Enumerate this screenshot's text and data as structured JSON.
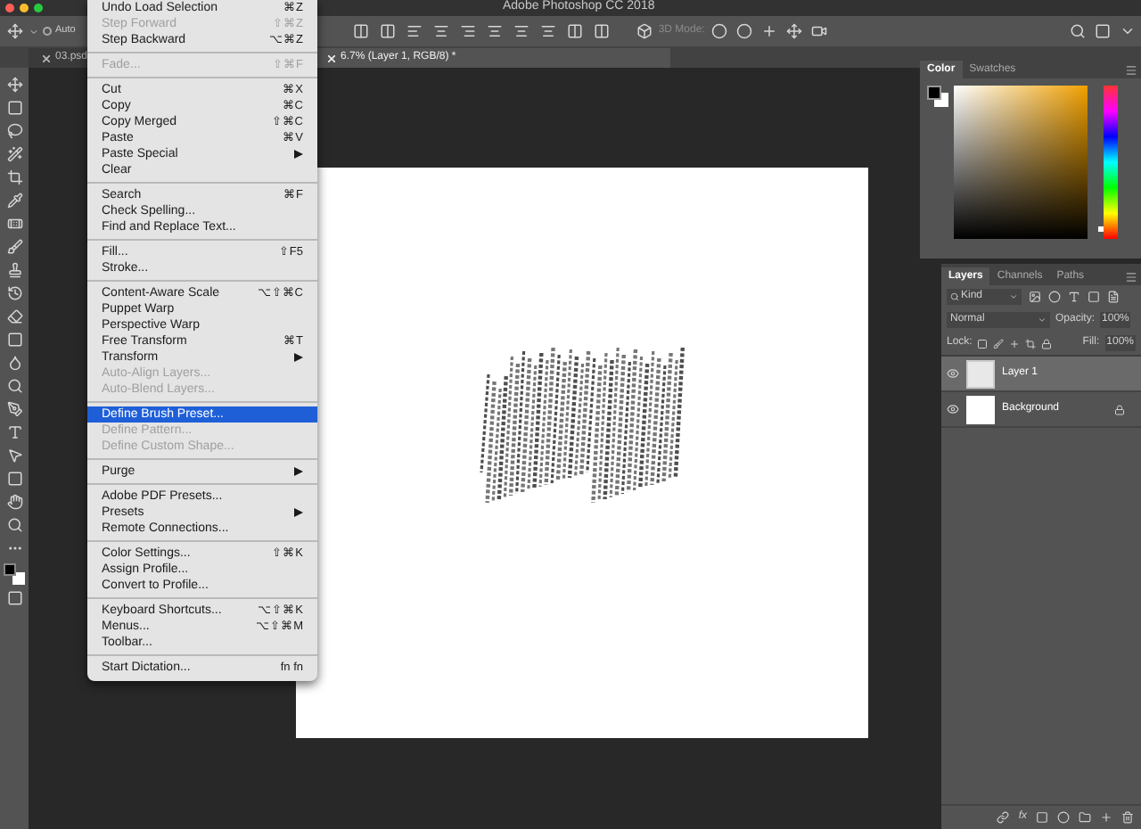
{
  "window": {
    "title": "Adobe Photoshop CC 2018"
  },
  "options_bar": {
    "auto_select": false,
    "auto_label": "Auto",
    "mode_label": "3D Mode:"
  },
  "tabs": [
    {
      "label": "03.psd",
      "selected": false
    },
    {
      "label": "6.7% (Layer 1, RGB/8) *",
      "selected": true
    }
  ],
  "edit_menu": [
    {
      "kind": "item",
      "label": "Undo Load Selection",
      "shortcut": "⌘Z",
      "disabled": false,
      "selected": false,
      "submenu": false
    },
    {
      "kind": "item",
      "label": "Step Forward",
      "shortcut": "⇧⌘Z",
      "disabled": true,
      "selected": false,
      "submenu": false
    },
    {
      "kind": "item",
      "label": "Step Backward",
      "shortcut": "⌥⌘Z",
      "disabled": false,
      "selected": false,
      "submenu": false
    },
    {
      "kind": "separator"
    },
    {
      "kind": "item",
      "label": "Fade...",
      "shortcut": "⇧⌘F",
      "disabled": true,
      "selected": false,
      "submenu": false
    },
    {
      "kind": "separator"
    },
    {
      "kind": "item",
      "label": "Cut",
      "shortcut": "⌘X",
      "disabled": false,
      "selected": false,
      "submenu": false
    },
    {
      "kind": "item",
      "label": "Copy",
      "shortcut": "⌘C",
      "disabled": false,
      "selected": false,
      "submenu": false
    },
    {
      "kind": "item",
      "label": "Copy Merged",
      "shortcut": "⇧⌘C",
      "disabled": false,
      "selected": false,
      "submenu": false
    },
    {
      "kind": "item",
      "label": "Paste",
      "shortcut": "⌘V",
      "disabled": false,
      "selected": false,
      "submenu": false
    },
    {
      "kind": "item",
      "label": "Paste Special",
      "disabled": false,
      "selected": false,
      "submenu": true
    },
    {
      "kind": "item",
      "label": "Clear",
      "disabled": false,
      "selected": false,
      "submenu": false
    },
    {
      "kind": "separator"
    },
    {
      "kind": "item",
      "label": "Search",
      "shortcut": "⌘F",
      "disabled": false,
      "selected": false,
      "submenu": false
    },
    {
      "kind": "item",
      "label": "Check Spelling...",
      "disabled": false,
      "selected": false,
      "submenu": false
    },
    {
      "kind": "item",
      "label": "Find and Replace Text...",
      "disabled": false,
      "selected": false,
      "submenu": false
    },
    {
      "kind": "separator"
    },
    {
      "kind": "item",
      "label": "Fill...",
      "shortcut": "⇧F5",
      "disabled": false,
      "selected": false,
      "submenu": false
    },
    {
      "kind": "item",
      "label": "Stroke...",
      "disabled": false,
      "selected": false,
      "submenu": false
    },
    {
      "kind": "separator"
    },
    {
      "kind": "item",
      "label": "Content-Aware Scale",
      "shortcut": "⌥⇧⌘C",
      "disabled": false,
      "selected": false,
      "submenu": false
    },
    {
      "kind": "item",
      "label": "Puppet Warp",
      "disabled": false,
      "selected": false,
      "submenu": false
    },
    {
      "kind": "item",
      "label": "Perspective Warp",
      "disabled": false,
      "selected": false,
      "submenu": false
    },
    {
      "kind": "item",
      "label": "Free Transform",
      "shortcut": "⌘T",
      "disabled": false,
      "selected": false,
      "submenu": false
    },
    {
      "kind": "item",
      "label": "Transform",
      "disabled": false,
      "selected": false,
      "submenu": true
    },
    {
      "kind": "item",
      "label": "Auto-Align Layers...",
      "disabled": true,
      "selected": false,
      "submenu": false
    },
    {
      "kind": "item",
      "label": "Auto-Blend Layers...",
      "disabled": true,
      "selected": false,
      "submenu": false
    },
    {
      "kind": "separator"
    },
    {
      "kind": "item",
      "label": "Define Brush Preset...",
      "disabled": false,
      "selected": true,
      "submenu": false
    },
    {
      "kind": "item",
      "label": "Define Pattern...",
      "disabled": true,
      "selected": false,
      "submenu": false
    },
    {
      "kind": "item",
      "label": "Define Custom Shape...",
      "disabled": true,
      "selected": false,
      "submenu": false
    },
    {
      "kind": "separator"
    },
    {
      "kind": "item",
      "label": "Purge",
      "disabled": false,
      "selected": false,
      "submenu": true
    },
    {
      "kind": "separator"
    },
    {
      "kind": "item",
      "label": "Adobe PDF Presets...",
      "disabled": false,
      "selected": false,
      "submenu": false
    },
    {
      "kind": "item",
      "label": "Presets",
      "disabled": false,
      "selected": false,
      "submenu": true
    },
    {
      "kind": "item",
      "label": "Remote Connections...",
      "disabled": false,
      "selected": false,
      "submenu": false
    },
    {
      "kind": "separator"
    },
    {
      "kind": "item",
      "label": "Color Settings...",
      "shortcut": "⇧⌘K",
      "disabled": false,
      "selected": false,
      "submenu": false
    },
    {
      "kind": "item",
      "label": "Assign Profile...",
      "disabled": false,
      "selected": false,
      "submenu": false
    },
    {
      "kind": "item",
      "label": "Convert to Profile...",
      "disabled": false,
      "selected": false,
      "submenu": false
    },
    {
      "kind": "separator"
    },
    {
      "kind": "item",
      "label": "Keyboard Shortcuts...",
      "shortcut": "⌥⇧⌘K",
      "disabled": false,
      "selected": false,
      "submenu": false
    },
    {
      "kind": "item",
      "label": "Menus...",
      "shortcut": "⌥⇧⌘M",
      "disabled": false,
      "selected": false,
      "submenu": false
    },
    {
      "kind": "item",
      "label": "Toolbar...",
      "disabled": false,
      "selected": false,
      "submenu": false
    },
    {
      "kind": "separator"
    },
    {
      "kind": "item",
      "label": "Start Dictation...",
      "shortcut": "fn fn",
      "disabled": false,
      "selected": false,
      "submenu": false
    }
  ],
  "color_panel": {
    "tabs": [
      {
        "label": "Color",
        "selected": true
      },
      {
        "label": "Swatches",
        "selected": false
      }
    ],
    "hue_slider": {
      "level": 0.08
    }
  },
  "layers_panel": {
    "tabs": [
      {
        "label": "Layers",
        "selected": true
      },
      {
        "label": "Channels",
        "selected": false
      },
      {
        "label": "Paths",
        "selected": false
      }
    ],
    "filter": "Kind",
    "fx_label": "fx",
    "blend_mode": "Normal",
    "opacity_label": "Opacity:",
    "opacity": "100%",
    "lock_label": "Lock:",
    "fill_label": "Fill:",
    "fill": "100%",
    "layers": [
      {
        "name": "Layer 1",
        "selected": true,
        "visible": true,
        "locked": false
      },
      {
        "name": "Background",
        "selected": false,
        "visible": true,
        "locked": true
      }
    ]
  }
}
